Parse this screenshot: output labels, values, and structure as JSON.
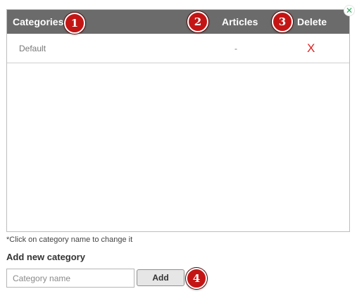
{
  "table": {
    "headers": {
      "categories": "Categories",
      "articles": "Articles",
      "delete": "Delete"
    },
    "rows": [
      {
        "name": "Default",
        "articles": "-",
        "delete": "X"
      }
    ]
  },
  "close_glyph": "✕",
  "callouts": [
    "1",
    "2",
    "3",
    "4"
  ],
  "hint": "*Click on category name to change it",
  "add_form": {
    "title": "Add new category",
    "placeholder": "Category name",
    "value": "",
    "button_label": "Add"
  },
  "colors": {
    "header_bg": "#6b6b6b",
    "delete_red": "#e02020",
    "callout_red": "#c41515",
    "close_green": "#2fae5f"
  }
}
